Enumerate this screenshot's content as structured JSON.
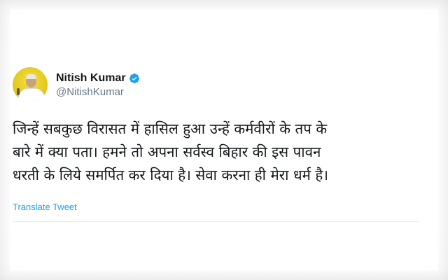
{
  "tweet": {
    "author": {
      "display_name": "Nitish Kumar",
      "handle": "@NitishKumar",
      "verified": true
    },
    "text_lines": [
      "जिन्हें सबकुछ विरासत में हासिल हुआ उन्हें कर्मवीरों के तप के",
      "बारे में क्या पता। हमने तो अपना सर्वस्व बिहार की इस पावन",
      "धरती के लिये समर्पित कर दिया है। सेवा करना ही मेरा धर्म है।"
    ],
    "translate_label": "Translate Tweet"
  },
  "colors": {
    "link_blue": "#1da1f2",
    "text_dark": "#14171a",
    "text_muted": "#657786",
    "avatar_yellow": "#e4c81c"
  },
  "icons": {
    "verified": "verified-badge-icon",
    "avatar": "profile-avatar"
  }
}
